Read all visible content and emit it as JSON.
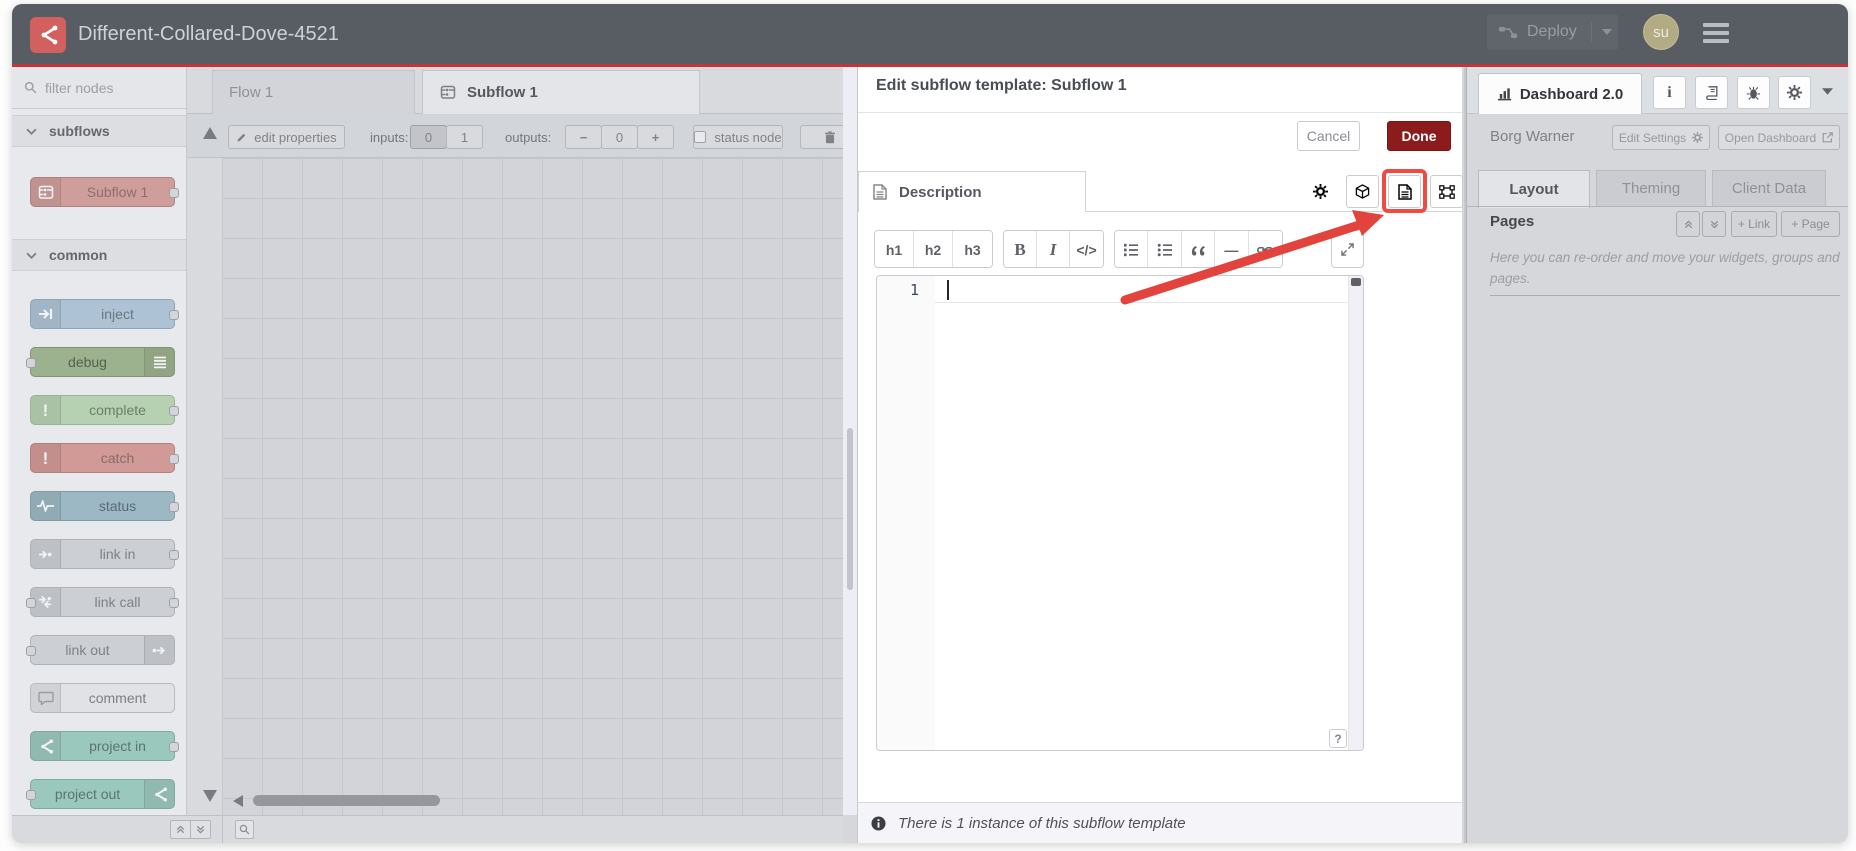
{
  "app": {
    "title": "Different-Collared-Dove-4521"
  },
  "header": {
    "deploy_label": "Deploy",
    "user_initials": "su"
  },
  "palette": {
    "filter_placeholder": "filter nodes",
    "sections": [
      {
        "label": "subflows",
        "nodes": [
          {
            "label": "Subflow 1",
            "icon": "subflow-node-icon",
            "icon_side": "left",
            "ports": [
              "right"
            ],
            "bg": "#cf9e9b",
            "border": "#ab8481",
            "text": "#8a6f6e"
          }
        ]
      },
      {
        "label": "common",
        "nodes": [
          {
            "label": "inject",
            "icon": "inject-icon",
            "icon_side": "left",
            "ports": [
              "right"
            ],
            "bg": "#adc3d5",
            "border": "#8fa5b7",
            "text": "#697683"
          },
          {
            "label": "debug",
            "icon": "debug-lines-icon",
            "icon_side": "right",
            "ports": [
              "left"
            ],
            "bg": "#9cb28f",
            "border": "#7f9573",
            "text": "#55614b"
          },
          {
            "label": "complete",
            "icon": "exclamation-icon",
            "icon_side": "left",
            "ports": [
              "right"
            ],
            "bg": "#b6d1b2",
            "border": "#97b392",
            "text": "#6b7d68"
          },
          {
            "label": "catch",
            "icon": "exclamation-icon",
            "icon_side": "left",
            "ports": [
              "right"
            ],
            "bg": "#d29a97",
            "border": "#b17f7c",
            "text": "#876b69"
          },
          {
            "label": "status",
            "icon": "status-pulse-icon",
            "icon_side": "left",
            "ports": [
              "right"
            ],
            "bg": "#9cb8c2",
            "border": "#7f9ca6",
            "text": "#586d75"
          },
          {
            "label": "link in",
            "icon": "link-in-icon",
            "icon_side": "left",
            "ports": [
              "right"
            ],
            "bg": "#cccfd3",
            "border": "#aeb1b6",
            "text": "#7e8187"
          },
          {
            "label": "link call",
            "icon": "link-call-icon",
            "icon_side": "left",
            "ports": [
              "left",
              "right"
            ],
            "bg": "#cccfd3",
            "border": "#aeb1b6",
            "text": "#7e8187"
          },
          {
            "label": "link out",
            "icon": "link-out-icon",
            "icon_side": "right",
            "ports": [
              "left"
            ],
            "bg": "#cccfd3",
            "border": "#aeb1b6",
            "text": "#7e8187"
          },
          {
            "label": "comment",
            "icon": "comment-bubble-icon",
            "icon_side": "left",
            "ports": [],
            "bg": "#e0e2e5",
            "border": "#b7b9be",
            "text": "#7b7e84"
          },
          {
            "label": "project in",
            "icon": "node-red-icon",
            "icon_side": "left",
            "ports": [
              "right"
            ],
            "bg": "#9bc8bd",
            "border": "#7fab9f",
            "text": "#5a756d"
          },
          {
            "label": "project out",
            "icon": "node-red-icon",
            "icon_side": "right",
            "ports": [
              "left"
            ],
            "bg": "#9bc8bd",
            "border": "#7fab9f",
            "text": "#5a756d"
          }
        ]
      }
    ]
  },
  "workspace": {
    "tabs": [
      {
        "label": "Flow 1"
      },
      {
        "label": "Subflow 1"
      }
    ],
    "active_tab": "Subflow 1",
    "toolbar": {
      "edit_properties": "edit properties",
      "inputs_label": "inputs:",
      "input_options": [
        "0",
        "1"
      ],
      "inputs_selected": "0",
      "outputs_label": "outputs:",
      "outputs_minus": "−",
      "outputs_value": "0",
      "outputs_plus": "+",
      "status_node": "status node"
    }
  },
  "tray": {
    "title": "Edit subflow template: Subflow 1",
    "cancel_label": "Cancel",
    "done_label": "Done",
    "tab_label": "Description",
    "md_toolbar_groups": [
      [
        "h1",
        "h2",
        "h3"
      ],
      [
        "B",
        "I",
        "</>"
      ],
      [
        "ol-icon",
        "ul-icon",
        "quote-icon",
        "hr-icon",
        "link-icon"
      ]
    ],
    "editor": {
      "line_number": "1",
      "help_label": "?"
    },
    "footer_text": "There is 1 instance of this subflow template"
  },
  "sidebar": {
    "tab_label": "Dashboard 2.0",
    "project_name": "Borg Warner",
    "edit_settings_label": "Edit Settings",
    "open_dashboard_label": "Open Dashboard",
    "tabs": [
      "Layout",
      "Theming",
      "Client Data"
    ],
    "active_tab": "Layout",
    "pages": {
      "title": "Pages",
      "link_button": "+ Link",
      "page_button": "+ Page",
      "help_text": "Here you can re-order and move your widgets, groups and pages."
    }
  },
  "annotation": {
    "arrow_color": "#e2433c",
    "box_color": "#ef4b42"
  },
  "colors": {
    "header_bg": "#585d64",
    "accent_red": "#c23637",
    "done_bg": "#8c1c1c",
    "canvas_bg": "#d2d4d9"
  }
}
